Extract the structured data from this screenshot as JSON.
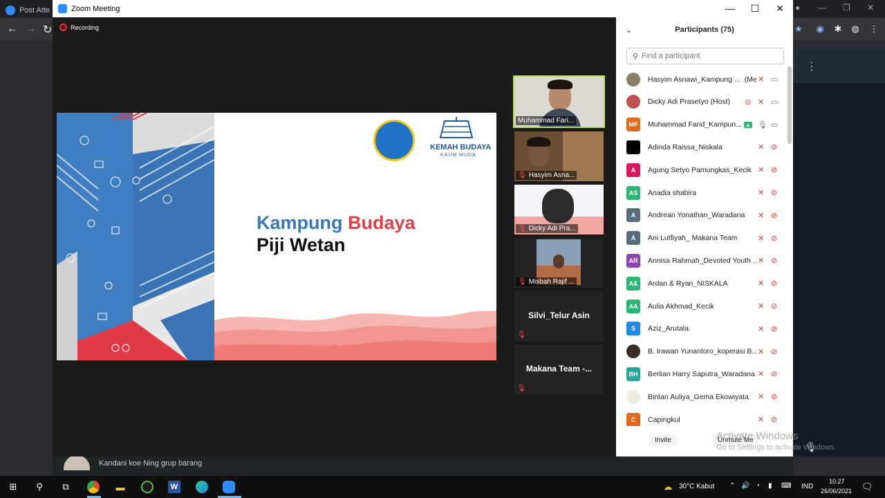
{
  "browser": {
    "tab_title": "Post Atte",
    "window_controls": [
      "—",
      "❐",
      "✕"
    ]
  },
  "background_chat": {
    "message_preview": "Kandani koe Ning grup barang"
  },
  "zoom": {
    "window_title": "Zoom Meeting",
    "recording_label": "Recording",
    "slide": {
      "title_word1": "Kampung",
      "title_word2": "Budaya",
      "subtitle": "Piji Wetan",
      "logo2_line1": "KEMAH BUDAYA",
      "logo2_line2": "KAUM MUDA"
    },
    "video_tiles": [
      {
        "name": "Muhammad Fari...",
        "active": true,
        "muted": false
      },
      {
        "name": "Hasyim Asna...",
        "active": false,
        "muted": true
      },
      {
        "name": "Dicky Adi Pra...",
        "active": false,
        "muted": true
      },
      {
        "name": "Misbah Rajif ...",
        "active": false,
        "muted": true
      },
      {
        "name": "Silvi_Telur Asin",
        "active": false,
        "muted": true
      },
      {
        "name": "Makana Team  -...",
        "active": false,
        "muted": true
      }
    ],
    "participants": {
      "title": "Participants (75)",
      "search_placeholder": "Find a participant",
      "invite_label": "Invite",
      "unmute_label": "Unmute Me",
      "list": [
        {
          "initials": "",
          "name": "Hasyim Asnawi_Kampung ...",
          "suffix": "(Me)",
          "color": "#8a7f6a",
          "photo": true
        },
        {
          "initials": "",
          "name": "Dicky Adi Prasetyo (Host)",
          "suffix": "",
          "color": "#c0504d",
          "photo": true
        },
        {
          "initials": "MF",
          "name": "Muhammad Farid_Kampun...",
          "suffix": "",
          "color": "#e06a1b",
          "photo": false
        },
        {
          "initials": "",
          "name": "Adinda Raissa_Niskala",
          "suffix": "",
          "color": "#000000",
          "photo": false
        },
        {
          "initials": "A",
          "name": "Agung Setyo Pamungkas_Kecik",
          "suffix": "",
          "color": "#d81b60",
          "photo": false
        },
        {
          "initials": "AS",
          "name": "Anadia shabira",
          "suffix": "",
          "color": "#2bb673",
          "photo": false
        },
        {
          "initials": "A",
          "name": "Andrean Yonathan_Waradana",
          "suffix": "",
          "color": "#546e7a",
          "photo": false
        },
        {
          "initials": "A",
          "name": "Ani Lutfiyah_ Makana Team",
          "suffix": "",
          "color": "#546e7a",
          "photo": false
        },
        {
          "initials": "AR",
          "name": "Annisa Rahmah_Devoted Youth ...",
          "suffix": "",
          "color": "#8e44ad",
          "photo": false
        },
        {
          "initials": "A&",
          "name": "Ardan & Ryan_NISKALA",
          "suffix": "",
          "color": "#2bb673",
          "photo": false
        },
        {
          "initials": "AA",
          "name": "Aulia Akhmad_Kecik",
          "suffix": "",
          "color": "#2bb673",
          "photo": false
        },
        {
          "initials": "S",
          "name": "Aziz_Arutala",
          "suffix": "",
          "color": "#1e88e5",
          "photo": false
        },
        {
          "initials": "",
          "name": "B. Irawan Yunantoro_koperasi B...",
          "suffix": "",
          "color": "#3b2a25",
          "photo": true
        },
        {
          "initials": "BH",
          "name": "Berlian Harry Saputra_Waradana",
          "suffix": "",
          "color": "#26a69a",
          "photo": false
        },
        {
          "initials": "",
          "name": "Bintan Auliya_Gema Ekowiyata",
          "suffix": "",
          "color": "#efe9e2",
          "photo": true
        },
        {
          "initials": "C",
          "name": "Capingkul",
          "suffix": "",
          "color": "#e06a1b",
          "photo": false
        }
      ]
    }
  },
  "windows": {
    "activate_line1": "Activate Windows",
    "activate_line2": "Go to Settings to activate Windows.",
    "weather": "30°C  Kabut",
    "language": "IND",
    "time": "10.27",
    "date": "26/06/2021"
  }
}
